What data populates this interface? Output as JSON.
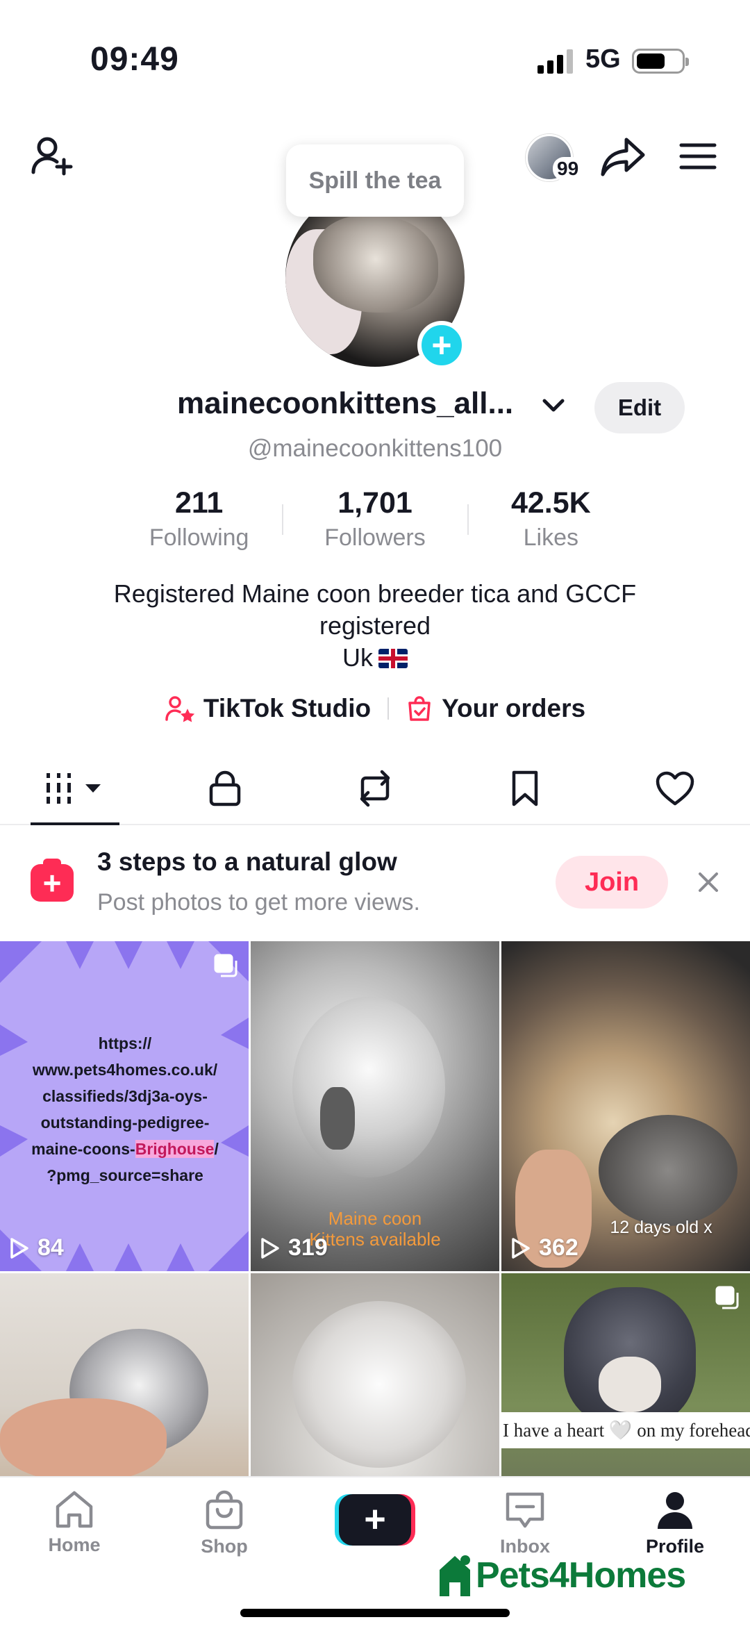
{
  "status": {
    "time": "09:49",
    "network": "5G"
  },
  "header": {
    "tooltip": "Spill the tea",
    "visitor_count": "99"
  },
  "profile": {
    "display_name": "mainecoonkittens_all...",
    "handle": "@mainecoonkittens100",
    "edit_label": "Edit"
  },
  "stats": [
    {
      "value": "211",
      "label": "Following"
    },
    {
      "value": "1,701",
      "label": "Followers"
    },
    {
      "value": "42.5K",
      "label": "Likes"
    }
  ],
  "bio": {
    "line1": "Registered Maine coon breeder tica and GCCF",
    "line2": "registered",
    "line3": "Uk"
  },
  "links": {
    "studio": "TikTok Studio",
    "orders": "Your orders"
  },
  "promo": {
    "title": "3 steps to a natural glow",
    "subtitle": "Post photos to get more views.",
    "join_label": "Join"
  },
  "videos": [
    {
      "views": "84",
      "url_parts": [
        "https://",
        "www.pets4homes.co.uk/",
        "classifieds/3dj3a-oys-",
        "outstanding-pedigree-",
        "maine-coons-",
        "Brighouse",
        "/",
        "?pmg_source=share"
      ]
    },
    {
      "views": "319",
      "overlay_line1": "Maine coon",
      "overlay_line2": "Kittens available"
    },
    {
      "views": "362",
      "overlay": "12 days old x"
    },
    {
      "views": ""
    },
    {
      "views": ""
    },
    {
      "views": "",
      "caption": "I have a heart 🤍 on my forehead"
    }
  ],
  "nav": {
    "home": "Home",
    "shop": "Shop",
    "inbox": "Inbox",
    "profile": "Profile"
  },
  "watermark": "Pets4Homes",
  "colors": {
    "accent_red": "#fe2c55",
    "accent_cyan": "#20d5ec",
    "watermark_green": "#0c7a3a"
  }
}
